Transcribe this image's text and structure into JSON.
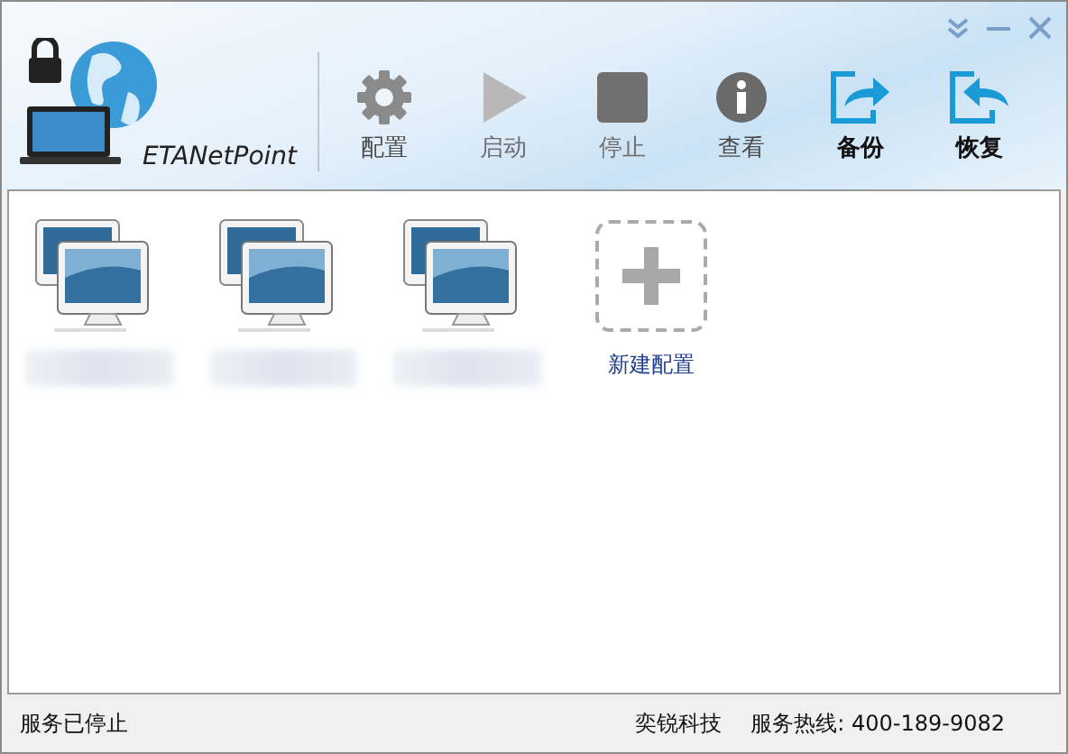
{
  "window": {
    "app_name": "ETANetPoint"
  },
  "toolbar": [
    {
      "kind": "gear",
      "label": "配置",
      "disabled": false,
      "highlighted": false
    },
    {
      "kind": "play",
      "label": "启动",
      "disabled": true,
      "highlighted": false
    },
    {
      "kind": "stop",
      "label": "停止",
      "disabled": true,
      "highlighted": false
    },
    {
      "kind": "info",
      "label": "查看",
      "disabled": false,
      "highlighted": false
    },
    {
      "kind": "export",
      "label": "备份",
      "disabled": false,
      "highlighted": true
    },
    {
      "kind": "import",
      "label": "恢复",
      "disabled": false,
      "highlighted": true
    }
  ],
  "configs": [
    {
      "kind": "computer"
    },
    {
      "kind": "computer"
    },
    {
      "kind": "computer"
    },
    {
      "kind": "new",
      "label": "新建配置"
    }
  ],
  "status_bar": {
    "status": "服务已停止",
    "company": "奕锐科技",
    "hotline": "服务热线: 400-189-9082"
  }
}
